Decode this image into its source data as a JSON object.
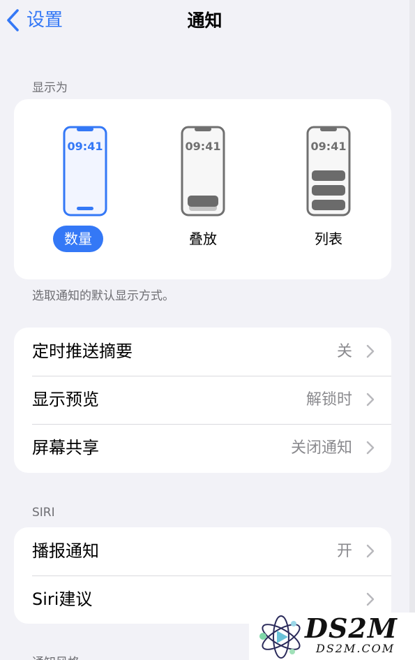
{
  "nav": {
    "back_label": "设置",
    "title": "通知"
  },
  "display_section": {
    "label": "显示为",
    "clock_time": "09:41",
    "options": [
      {
        "label": "数量",
        "selected": true
      },
      {
        "label": "叠放",
        "selected": false
      },
      {
        "label": "列表",
        "selected": false
      }
    ],
    "footer": "选取通知的默认显示方式。"
  },
  "settings_group": {
    "rows": [
      {
        "label": "定时推送摘要",
        "value": "关"
      },
      {
        "label": "显示预览",
        "value": "解锁时"
      },
      {
        "label": "屏幕共享",
        "value": "关闭通知"
      }
    ]
  },
  "siri_section": {
    "label": "SIRI",
    "rows": [
      {
        "label": "播报通知",
        "value": "开"
      },
      {
        "label": "Siri建议",
        "value": ""
      }
    ]
  },
  "partial_section_label": "通知风格",
  "watermark": {
    "brand": "DS2M",
    "domain": "DS2M.COM"
  },
  "colors": {
    "accent": "#3478f6",
    "background": "#f2f2f7",
    "secondary_text": "#8a8a8e"
  }
}
